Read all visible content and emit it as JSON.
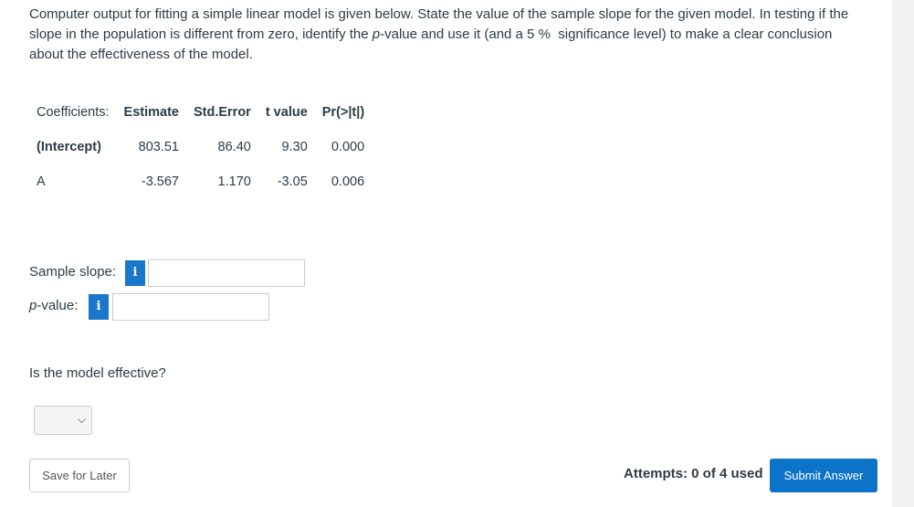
{
  "question": {
    "part1": "Computer output for fitting a simple linear model is given below. State the value of the sample slope for the given model. In testing if the slope in the population is different from zero, identify the ",
    "p_italic": "p",
    "part2": "-value and use it (and a 5 %  significance level) to make a clear conclusion about the effectiveness of the model."
  },
  "table": {
    "headers": [
      "Coefficients:",
      "Estimate",
      "Std.Error",
      "t value",
      "Pr(>|t|)"
    ],
    "rows": [
      {
        "label": "(Intercept)",
        "cells": [
          "803.51",
          "86.40",
          "9.30",
          "0.000"
        ]
      },
      {
        "label": "A",
        "cells": [
          "-3.567",
          "1.170",
          "-3.05",
          "0.006"
        ]
      }
    ]
  },
  "fields": {
    "slope_label": "Sample slope:",
    "p_italic": "p",
    "pvalue_suffix": "-value:",
    "info_glyph": "i",
    "slope_value": "",
    "pvalue_value": ""
  },
  "effective": {
    "question": "Is the model effective?",
    "selected": ""
  },
  "footer": {
    "save_label": "Save for Later",
    "attempts": "Attempts: 0 of 4 used",
    "submit_label": "Submit Answer"
  },
  "colors": {
    "accent": "#0b73c8",
    "info_bg": "#1a77c9"
  },
  "icons": {
    "info": "info-icon",
    "dropdown": "chevron-down-icon"
  }
}
